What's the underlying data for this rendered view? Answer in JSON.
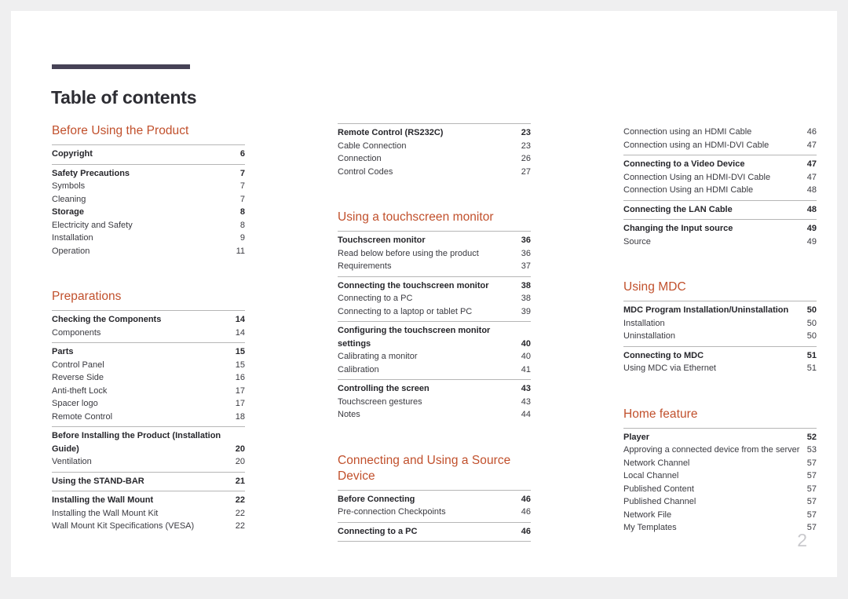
{
  "page": {
    "title": "Table of contents",
    "folio": "2",
    "accent_color": "#c1502c",
    "rule_color": "#464256"
  },
  "columns": [
    {
      "name": "column-1",
      "sections": [
        {
          "heading": "Before Using the Product",
          "groups": [
            {
              "entries": [
                {
                  "label": "Copyright",
                  "page": "6",
                  "bold": true
                }
              ]
            },
            {
              "entries": [
                {
                  "label": "Safety Precautions",
                  "page": "7",
                  "bold": true
                },
                {
                  "label": "Symbols",
                  "page": "7",
                  "bold": false
                },
                {
                  "label": "Cleaning",
                  "page": "7",
                  "bold": false
                },
                {
                  "label": "Storage",
                  "page": "8",
                  "bold": true
                },
                {
                  "label": "Electricity and Safety",
                  "page": "8",
                  "bold": false
                },
                {
                  "label": "Installation",
                  "page": "9",
                  "bold": false
                },
                {
                  "label": "Operation",
                  "page": "11",
                  "bold": false
                }
              ]
            }
          ]
        },
        {
          "heading": "Preparations",
          "groups": [
            {
              "entries": [
                {
                  "label": "Checking the Components",
                  "page": "14",
                  "bold": true
                },
                {
                  "label": "Components",
                  "page": "14",
                  "bold": false
                }
              ]
            },
            {
              "entries": [
                {
                  "label": "Parts",
                  "page": "15",
                  "bold": true
                },
                {
                  "label": "Control Panel",
                  "page": "15",
                  "bold": false
                },
                {
                  "label": "Reverse Side",
                  "page": "16",
                  "bold": false
                },
                {
                  "label": "Anti-theft Lock",
                  "page": "17",
                  "bold": false
                },
                {
                  "label": "Spacer logo",
                  "page": "17",
                  "bold": false
                },
                {
                  "label": "Remote Control",
                  "page": "18",
                  "bold": false
                }
              ]
            },
            {
              "entries": [
                {
                  "label": "Before Installing the Product (Installation Guide)",
                  "page": "20",
                  "bold": true,
                  "wrap": true
                },
                {
                  "label": "Ventilation",
                  "page": "20",
                  "bold": false
                }
              ]
            },
            {
              "entries": [
                {
                  "label": "Using the STAND-BAR",
                  "page": "21",
                  "bold": true
                }
              ]
            },
            {
              "entries": [
                {
                  "label": "Installing the Wall Mount",
                  "page": "22",
                  "bold": true
                },
                {
                  "label": "Installing the Wall Mount Kit",
                  "page": "22",
                  "bold": false
                },
                {
                  "label": "Wall Mount Kit Specifications (VESA)",
                  "page": "22",
                  "bold": false
                }
              ]
            }
          ]
        }
      ]
    },
    {
      "name": "column-2",
      "sections": [
        {
          "heading": "",
          "groups": [
            {
              "entries": [
                {
                  "label": "Remote Control (RS232C)",
                  "page": "23",
                  "bold": true
                },
                {
                  "label": "Cable Connection",
                  "page": "23",
                  "bold": false
                },
                {
                  "label": "Connection",
                  "page": "26",
                  "bold": false
                },
                {
                  "label": "Control Codes",
                  "page": "27",
                  "bold": false
                }
              ]
            }
          ]
        },
        {
          "heading": "Using a touchscreen monitor",
          "groups": [
            {
              "entries": [
                {
                  "label": "Touchscreen monitor",
                  "page": "36",
                  "bold": true
                },
                {
                  "label": "Read below before using the product",
                  "page": "36",
                  "bold": false
                },
                {
                  "label": "Requirements",
                  "page": "37",
                  "bold": false
                }
              ]
            },
            {
              "entries": [
                {
                  "label": "Connecting the touchscreen monitor",
                  "page": "38",
                  "bold": true
                },
                {
                  "label": "Connecting to a PC",
                  "page": "38",
                  "bold": false
                },
                {
                  "label": "Connecting to a laptop or tablet PC",
                  "page": "39",
                  "bold": false
                }
              ]
            },
            {
              "entries": [
                {
                  "label": "Configuring the touchscreen monitor settings",
                  "page": "40",
                  "bold": true,
                  "wrap": true
                },
                {
                  "label": "Calibrating a monitor",
                  "page": "40",
                  "bold": false
                },
                {
                  "label": "Calibration",
                  "page": "41",
                  "bold": false
                }
              ]
            },
            {
              "entries": [
                {
                  "label": "Controlling the screen",
                  "page": "43",
                  "bold": true
                },
                {
                  "label": "Touchscreen gestures",
                  "page": "43",
                  "bold": false
                },
                {
                  "label": "Notes",
                  "page": "44",
                  "bold": false
                }
              ]
            }
          ]
        },
        {
          "heading": "Connecting and Using a Source Device",
          "groups": [
            {
              "entries": [
                {
                  "label": "Before Connecting",
                  "page": "46",
                  "bold": true
                },
                {
                  "label": "Pre-connection Checkpoints",
                  "page": "46",
                  "bold": false
                }
              ]
            },
            {
              "entries": [
                {
                  "label": "Connecting to a PC",
                  "page": "46",
                  "bold": true
                }
              ],
              "last": true
            }
          ]
        }
      ]
    },
    {
      "name": "column-3",
      "sections": [
        {
          "heading": "",
          "groups": [
            {
              "entries": [
                {
                  "label": "Connection using an HDMI Cable",
                  "page": "46",
                  "bold": false
                },
                {
                  "label": "Connection using an HDMI-DVI Cable",
                  "page": "47",
                  "bold": false
                }
              ],
              "no_rule": true
            },
            {
              "entries": [
                {
                  "label": "Connecting to a Video Device",
                  "page": "47",
                  "bold": true
                },
                {
                  "label": "Connection Using an HDMI-DVI Cable",
                  "page": "47",
                  "bold": false
                },
                {
                  "label": "Connection Using an HDMI Cable",
                  "page": "48",
                  "bold": false
                }
              ]
            },
            {
              "entries": [
                {
                  "label": "Connecting the LAN Cable",
                  "page": "48",
                  "bold": true
                }
              ]
            },
            {
              "entries": [
                {
                  "label": "Changing the Input source",
                  "page": "49",
                  "bold": true
                },
                {
                  "label": "Source",
                  "page": "49",
                  "bold": false
                }
              ]
            }
          ]
        },
        {
          "heading": "Using MDC",
          "groups": [
            {
              "entries": [
                {
                  "label": "MDC Program Installation/Uninstallation",
                  "page": "50",
                  "bold": true
                },
                {
                  "label": "Installation",
                  "page": "50",
                  "bold": false
                },
                {
                  "label": "Uninstallation",
                  "page": "50",
                  "bold": false
                }
              ]
            },
            {
              "entries": [
                {
                  "label": "Connecting to MDC",
                  "page": "51",
                  "bold": true
                },
                {
                  "label": "Using MDC via Ethernet",
                  "page": "51",
                  "bold": false
                }
              ]
            }
          ]
        },
        {
          "heading": "Home feature",
          "groups": [
            {
              "entries": [
                {
                  "label": "Player",
                  "page": "52",
                  "bold": true
                },
                {
                  "label": "Approving a connected device from the server",
                  "page": "53",
                  "bold": false
                },
                {
                  "label": "Network Channel",
                  "page": "57",
                  "bold": false
                },
                {
                  "label": "Local Channel",
                  "page": "57",
                  "bold": false
                },
                {
                  "label": "Published Content",
                  "page": "57",
                  "bold": false
                },
                {
                  "label": "Published Channel",
                  "page": "57",
                  "bold": false
                },
                {
                  "label": "Network File",
                  "page": "57",
                  "bold": false
                },
                {
                  "label": "My Templates",
                  "page": "57",
                  "bold": false
                }
              ]
            }
          ]
        }
      ]
    }
  ]
}
